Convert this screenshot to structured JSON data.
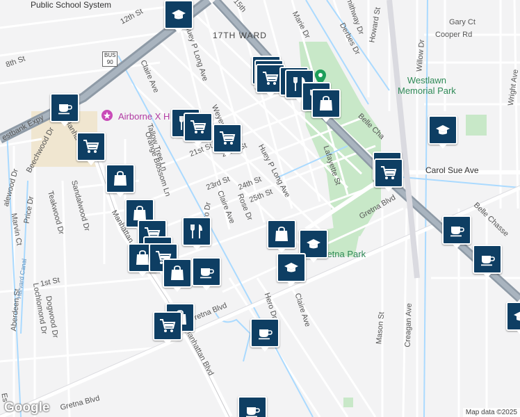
{
  "labels": {
    "public_school_system": "Public School System",
    "st_12th": "12th St",
    "st_15th": "15th",
    "st_8th": "8th St",
    "westbank_expy": "estbank Expy",
    "ward_17th": "17TH WARD",
    "marie_dr": "Marie Dr",
    "smithway_dr": "Smithway Dr",
    "derbes_dr": "Derbes Dr",
    "howard_st": "Howard St",
    "gary_ct": "Gary Ct",
    "cooper_rd": "Cooper Rd",
    "willow_dr": "Willow Dr",
    "westlawn_park": "Westlawn\nMemorial Park",
    "huey_p_long_ave_north": "Huey P Long Ave",
    "claire_ave_north": "Claire Ave",
    "weyer": "Weyer",
    "airborne": "Airborne X H",
    "st_21st": "21st St",
    "st_22nd": "22nd St",
    "huey_p_long_ave_mid": "Huey P Long Ave",
    "lafayette_st": "Lafayette St",
    "belle_chasse": "Belle Cha",
    "belle_chasse_hwy": "Belle Chasse",
    "carol_sue_ave": "Carol Sue Ave",
    "wright_ave": "Wright Ave",
    "tallow_tree_ln": "Tallow Tree Ln",
    "orange_blossom_ln": "Orange Blossom Ln",
    "manhattan_north": "Manhattan",
    "beechwood_dr": "Beechwood Dr",
    "sandalwood_dr": "Sandalwood Dr",
    "teakwood_dr": "Teakwood Dr",
    "price_dr": "Price Dr",
    "marvin_ct": "Marvin Ct",
    "alewood_dr": "alewood Dr",
    "st_23rd": "23rd St",
    "st_24th": "24th St",
    "st_25th": "25th St",
    "claire_ave_mid": "Claire Ave",
    "rose_dr": "Rose Dr",
    "hero_dr_north": "Hero Dr",
    "gretna_blvd_east": "Gretna Blvd",
    "gretna_park": "Gretna Park",
    "st_1st": "1st St",
    "manhattan_mid": "Manhattan",
    "dogwood_dr": "Dogwood Dr",
    "lochlomond_dr": "Lochlomond Dr",
    "aberdeen_st": "Aberdeen St",
    "harvard_canal": "Harvard Canal",
    "gretna_blvd_mid": "Gretna Blvd",
    "hero_dr_south": "Hero Dr",
    "claire_ave_south": "Claire Ave",
    "manhattan_blvd": "Manhattan Blvd",
    "mason_st": "Mason St",
    "creagan_ave": "Creagan Ave",
    "gretna_blvd_west": "Gretna Blvd",
    "es": "Es"
  },
  "shields": {
    "bus_top": "BUS",
    "bus_num": "90"
  },
  "branding": {
    "google": "Google",
    "attribution": "Map data ©2025"
  },
  "markers": [
    {
      "type": "school-icon"
    },
    {
      "type": "coffee-icon"
    },
    {
      "type": "cart-icon"
    },
    {
      "type": "cart-icon"
    },
    {
      "type": "cart-icon"
    },
    {
      "type": "restaurant-icon"
    },
    {
      "type": "restaurant-icon"
    },
    {
      "type": "restaurant-icon"
    },
    {
      "type": "bag-icon"
    },
    {
      "type": "cart-icon"
    },
    {
      "type": "restaurant-icon"
    },
    {
      "type": "cart-icon"
    },
    {
      "type": "bag-icon"
    },
    {
      "type": "school-icon"
    },
    {
      "type": "cart-icon"
    },
    {
      "type": "cart-icon"
    },
    {
      "type": "bag-icon"
    },
    {
      "type": "bag-icon"
    },
    {
      "type": "cart-icon"
    },
    {
      "type": "restaurant-icon"
    },
    {
      "type": "restaurant-icon"
    },
    {
      "type": "bag-icon"
    },
    {
      "type": "cart-icon"
    },
    {
      "type": "bag-icon"
    },
    {
      "type": "coffee-icon"
    },
    {
      "type": "bag-icon"
    },
    {
      "type": "school-icon"
    },
    {
      "type": "school-icon"
    },
    {
      "type": "coffee-icon"
    },
    {
      "type": "coffee-icon"
    },
    {
      "type": "bag-icon"
    },
    {
      "type": "cart-icon"
    },
    {
      "type": "coffee-icon"
    },
    {
      "type": "coffee-icon"
    },
    {
      "type": "school-icon"
    }
  ]
}
